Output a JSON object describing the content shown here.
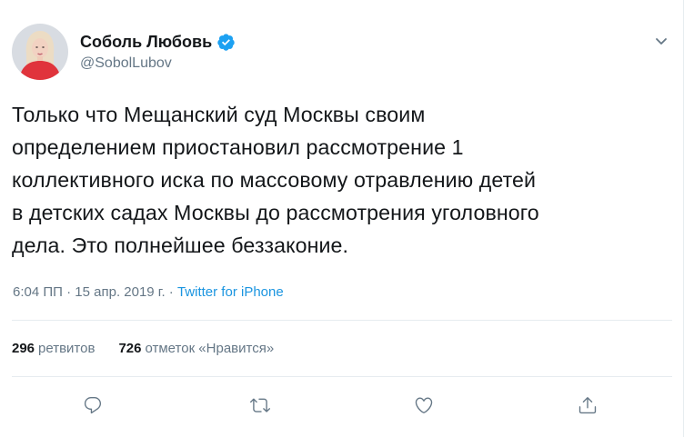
{
  "author": {
    "name": "Соболь Любовь",
    "handle": "@SobolLubov",
    "verified": true
  },
  "tweet": {
    "text": "Только что Мещанский суд Москвы своим\nопределением приостановил рассмотрение 1\nколлективного иска по массовому отравлению детей\nв детских садах Москвы до рассмотрения уголовного\nдела. Это полнейшее беззаконие.",
    "time": "6:04 ПП",
    "date": "15 апр. 2019 г.",
    "separator": " · ",
    "source": "Twitter for iPhone"
  },
  "stats": {
    "retweets_count": "296",
    "retweets_label": "ретвитов",
    "likes_count": "726",
    "likes_label": "отметок «Нравится»"
  },
  "icons": {
    "reply": "reply-icon",
    "retweet": "retweet-icon",
    "like": "heart-icon",
    "share": "share-icon",
    "menu": "chevron-down-icon",
    "verified": "verified-badge-icon"
  },
  "colors": {
    "accent": "#1b95e0",
    "verified": "#1da1f2",
    "secondary_text": "#657786",
    "primary_text": "#14171a",
    "divider": "#e6ecf0"
  }
}
